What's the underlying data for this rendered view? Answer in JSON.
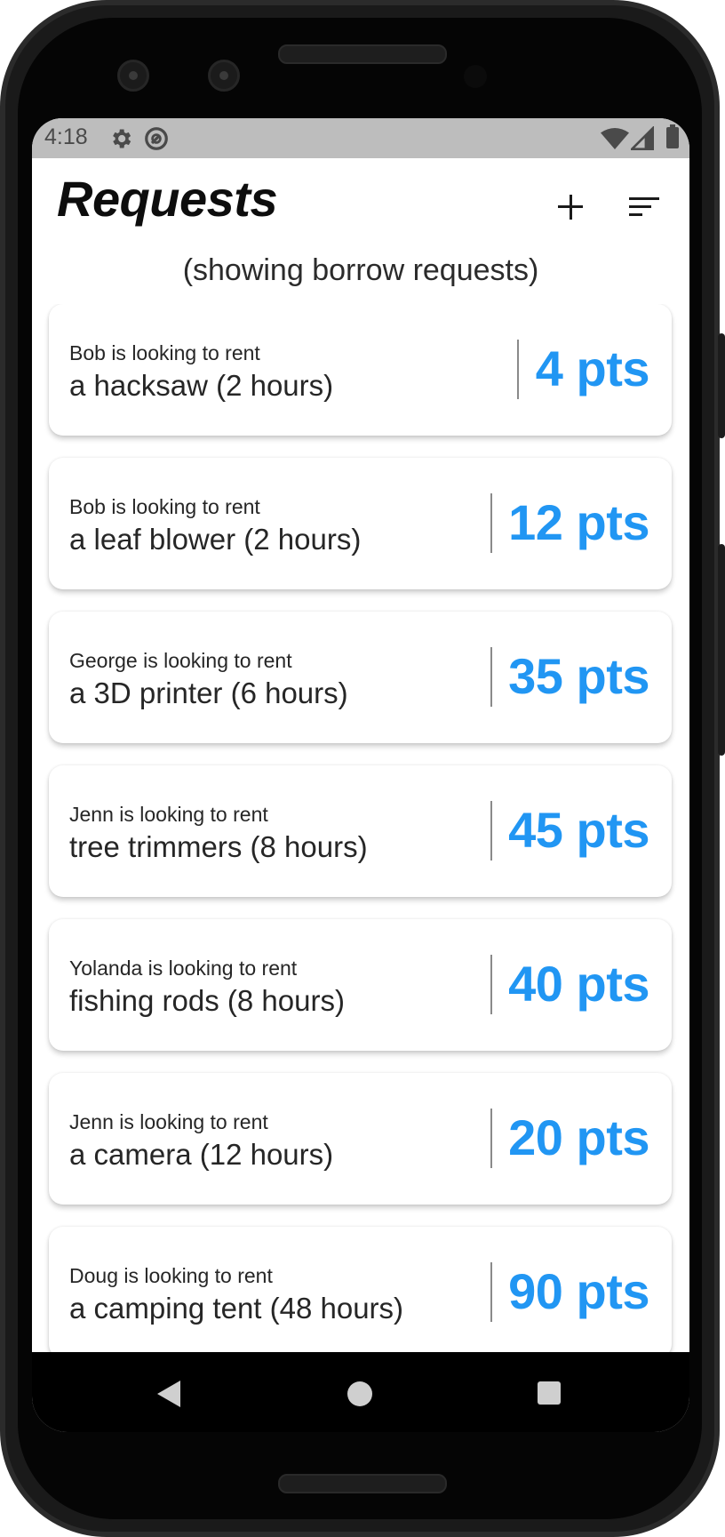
{
  "status_bar": {
    "time": "4:18"
  },
  "header": {
    "title": "Requests",
    "add_icon": "plus-icon",
    "sort_icon": "sort-icon"
  },
  "subtitle": "(showing borrow requests)",
  "accent_color": "#2196f3",
  "requests": [
    {
      "line1": "Bob is looking to rent",
      "line2": "a hacksaw (2 hours)",
      "points": "4 pts"
    },
    {
      "line1": "Bob is looking to rent",
      "line2": "a leaf blower (2 hours)",
      "points": "12 pts"
    },
    {
      "line1": "George is looking to rent",
      "line2": "a 3D printer (6 hours)",
      "points": "35 pts"
    },
    {
      "line1": "Jenn is looking to rent",
      "line2": "tree trimmers (8 hours)",
      "points": "45 pts"
    },
    {
      "line1": "Yolanda is looking to rent",
      "line2": "fishing rods (8 hours)",
      "points": "40 pts"
    },
    {
      "line1": "Jenn is looking to rent",
      "line2": "a camera (12 hours)",
      "points": "20 pts"
    },
    {
      "line1": "Doug is looking to rent",
      "line2": "a camping tent (48 hours)",
      "points": "90 pts"
    }
  ]
}
